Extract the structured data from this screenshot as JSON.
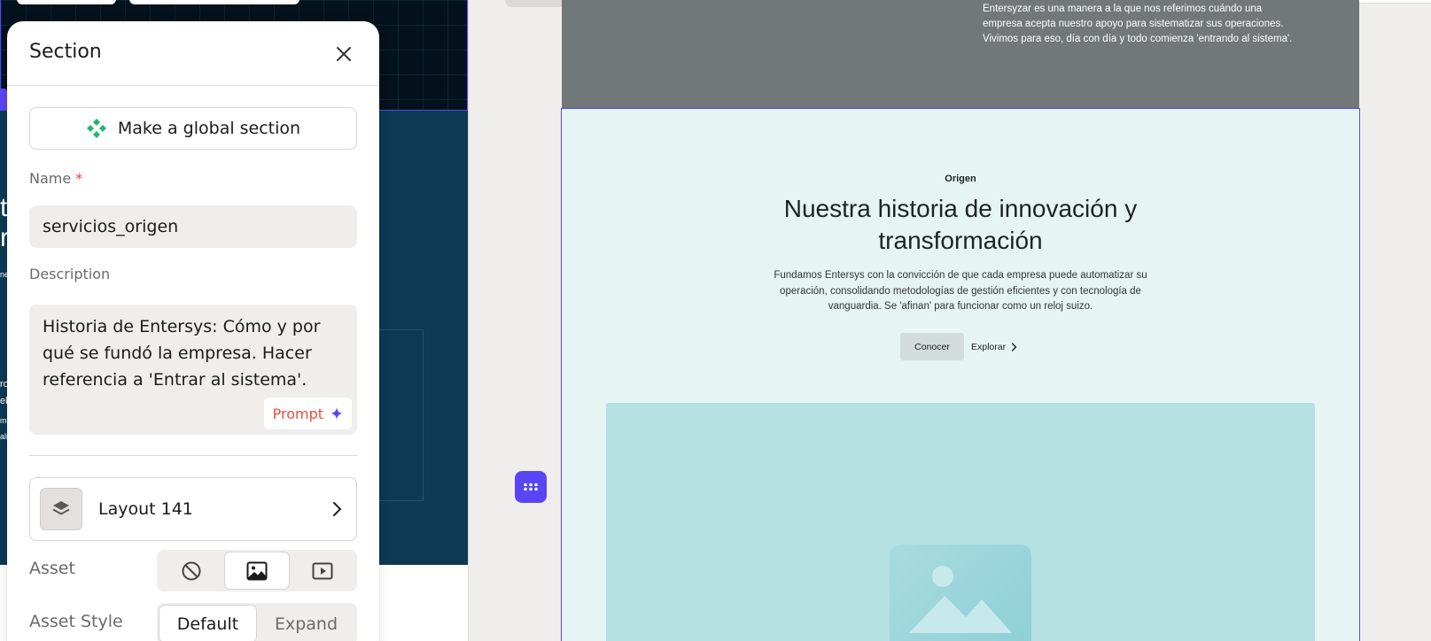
{
  "panel": {
    "title": "Section",
    "global_button_label": "Make a global section",
    "name_label": "Name",
    "name_required_mark": "*",
    "name_value": "servicios_origen",
    "description_label": "Description",
    "description_value": "Historia de Entersys: Cómo y por qué se fundó la empresa. Hacer referencia a 'Entrar al sistema'.",
    "prompt_label": "Prompt",
    "layout_name": "Layout 141",
    "asset_label": "Asset",
    "asset_options": [
      "none-icon",
      "image-icon",
      "video-icon"
    ],
    "asset_selected": "image",
    "asset_style_label": "Asset Style",
    "asset_style_options": [
      "Default",
      "Expand"
    ],
    "asset_style_selected": "Default"
  },
  "preview": {
    "top_text": "Entersyzar es una manera a la que nos referimos cuándo una empresa acepta nuestro apoyo para sistematizar sus operaciones. Vivimos para eso, día con día y todo comienza 'entrando al sistema'.",
    "tagline": "Origen",
    "heading": "Nuestra historia de innovación y transformación",
    "subtext": "Fundamos Entersys con la convicción de que cada empresa puede automatizar su operación, consolidando metodologías de gestión eficientes y con tecnología de vanguardia. Se 'afinan' para funcionar como un reloj suizo.",
    "primary_button": "Conocer",
    "secondary_button": "Explorar"
  },
  "left_canvas_fragments": {
    "frag_t": "t",
    "frag_r": "r",
    "frag_ne": "ne",
    "frag_ro": "ro",
    "frag_el": "el",
    "frag_m": "m",
    "frag_ali": "ali"
  },
  "colors": {
    "accent": "#5a45f5",
    "prompt": "#e8503a",
    "global_icon": "#22b573",
    "preview_bg": "#e6f4f4",
    "preview_image": "#b5e1e2",
    "dark_blue": "#0c3a52"
  }
}
